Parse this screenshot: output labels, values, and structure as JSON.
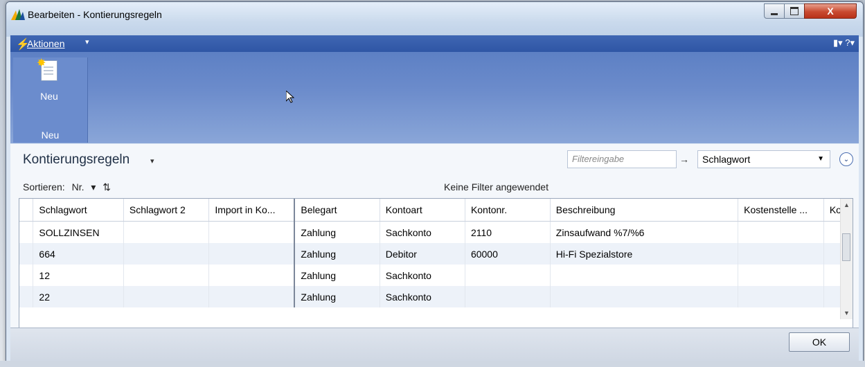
{
  "window": {
    "title": "Bearbeiten - Kontierungsregeln",
    "close_glyph": "X"
  },
  "actionbar": {
    "label": "Aktionen",
    "caret": "▾",
    "right_icons": "▮▾ ?▾"
  },
  "ribbon": {
    "button_label": "Neu",
    "group_label": "Neu"
  },
  "list": {
    "title": "Kontierungsregeln",
    "title_caret": "▾",
    "filter_placeholder": "Filtereingabe",
    "filter_field": "Schlagwort",
    "sort_label": "Sortieren:",
    "sort_field": "Nr.",
    "no_filter_text": "Keine Filter angewendet"
  },
  "table": {
    "columns": [
      "Schlagwort",
      "Schlagwort 2",
      "Import in Ko...",
      "Belegart",
      "Kontoart",
      "Kontonr.",
      "Beschreibung",
      "Kostenstelle ...",
      "Kos"
    ],
    "rows": [
      [
        "SOLLZINSEN",
        "",
        "",
        "Zahlung",
        "Sachkonto",
        "2110",
        "Zinsaufwand %7/%6",
        "",
        ""
      ],
      [
        "664",
        "",
        "",
        "Zahlung",
        "Debitor",
        "60000",
        "Hi-Fi Spezialstore",
        "",
        ""
      ],
      [
        "12",
        "",
        "",
        "Zahlung",
        "Sachkonto",
        "",
        "",
        "",
        ""
      ],
      [
        "22",
        "",
        "",
        "Zahlung",
        "Sachkonto",
        "",
        "",
        "",
        ""
      ]
    ]
  },
  "footer": {
    "ok_label": "OK"
  },
  "colors": {
    "ribbon": "#6b8bcb",
    "actionbar": "#3f66b3",
    "close": "#c94a30"
  }
}
